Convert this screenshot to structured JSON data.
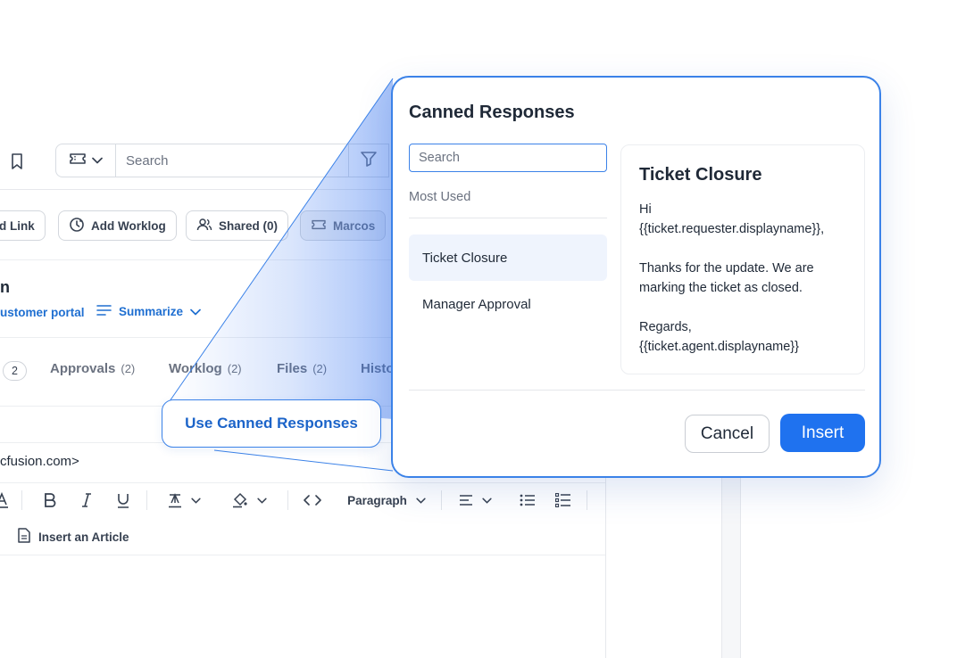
{
  "header": {
    "search_placeholder": "Search"
  },
  "actions": {
    "link_label": "d Link",
    "worklog_label": "Add Worklog",
    "shared_label": "Shared (0)",
    "agent_label": "Marcos"
  },
  "ticket": {
    "title_fragment": "n",
    "portal_link": "ustomer portal",
    "summarize_label": "Summarize"
  },
  "tabs": {
    "first_count": "2",
    "items": [
      {
        "label": "Approvals",
        "count": "(2)"
      },
      {
        "label": "Worklog",
        "count": "(2)"
      },
      {
        "label": "Files",
        "count": "(2)"
      },
      {
        "label": "Histo",
        "count": ""
      }
    ]
  },
  "composer": {
    "to_fragment": "cfusion.com>",
    "paragraph_label": "Paragraph",
    "insert_article_label": "Insert an Article"
  },
  "callout": {
    "label": "Use Canned Responses"
  },
  "modal": {
    "title": "Canned Responses",
    "search_placeholder": "Search",
    "section_label": "Most Used",
    "items": [
      {
        "label": "Ticket Closure",
        "active": true
      },
      {
        "label": "Manager Approval",
        "active": false
      }
    ],
    "preview": {
      "title": "Ticket Closure",
      "lines": [
        "Hi",
        "{{ticket.requester.displayname}},",
        "",
        "Thanks for the update. We are",
        "marking the ticket as closed.",
        "",
        "Regards,",
        "{{ticket.agent.displayname}}"
      ]
    },
    "cancel_label": "Cancel",
    "insert_label": "Insert"
  },
  "icons": {
    "bookmark": "bookmark-icon",
    "ticket": "ticket-icon",
    "filter": "filter-icon",
    "clock": "clock-icon",
    "users": "users-icon",
    "summarize": "lines-icon",
    "document": "document-icon"
  },
  "colors": {
    "accent": "#1f72ef",
    "link": "#1f6fd1",
    "callout_border": "#3b82e8"
  }
}
